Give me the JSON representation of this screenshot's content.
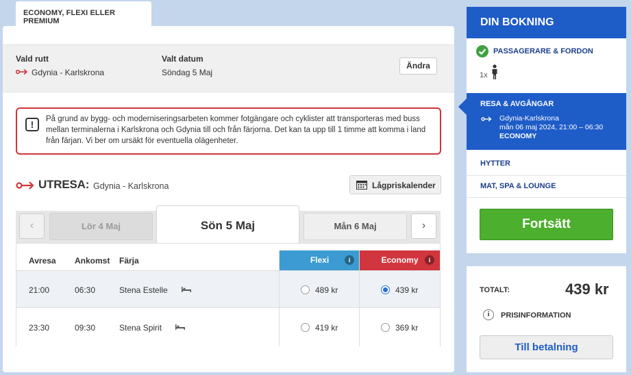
{
  "tab": {
    "label": "ECONOMY, FLEXI ELLER PREMIUM"
  },
  "route": {
    "route_label": "Vald rutt",
    "route_value": "Gdynia - Karlskrona",
    "date_label": "Valt datum",
    "date_value": "Söndag 5 Maj",
    "change_button": "Ändra"
  },
  "alert": {
    "icon": "!",
    "text": "På grund av bygg- och moderniseringsarbeten kommer fotgängare och cyklister att transporteras med buss mellan terminalerna i Karlskrona och Gdynia till och från färjorna. Det kan ta upp till 1 timme att komma i land från färjan. Vi ber om ursäkt för eventuella olägenheter."
  },
  "outbound": {
    "title": "UTRESA:",
    "route": "Gdynia - Karlskrona",
    "calendar_button": "Lågpriskalender"
  },
  "dates": {
    "prev": "Lör 4 Maj",
    "selected": "Sön 5 Maj",
    "next": "Mån 6 Maj",
    "left_arrow": "‹",
    "right_arrow": "›"
  },
  "table": {
    "headers": {
      "depart": "Avresa",
      "arrive": "Ankomst",
      "ferry": "Färja",
      "flexi": "Flexi",
      "economy": "Economy",
      "info": "i"
    },
    "rows": [
      {
        "depart": "21:00",
        "arrive": "06:30",
        "ferry": "Stena Estelle",
        "flexi_price": "489 kr",
        "economy_price": "439 kr",
        "selected": "economy"
      },
      {
        "depart": "23:30",
        "arrive": "09:30",
        "ferry": "Stena Spirit",
        "flexi_price": "419 kr",
        "economy_price": "369 kr",
        "selected": "none"
      }
    ]
  },
  "booking": {
    "title": "DIN BOKNING",
    "step_passengers": "PASSAGERARE & FORDON",
    "passenger_count": "1x",
    "step_trip": "RESA & AVGÅNGAR",
    "trip_route": "Gdynia-Karlskrona",
    "trip_time": "mån 06 maj 2024, 21:00 – 06:30",
    "trip_class": "ECONOMY",
    "step_cabins": "HYTTER",
    "step_food": "MAT, SPA & LOUNGE",
    "continue_button": "Fortsätt"
  },
  "total": {
    "label": "TOTALT:",
    "amount": "439 kr",
    "price_info": "PRISINFORMATION",
    "info_icon": "i",
    "pay_button": "Till betalning"
  },
  "colors": {
    "brand_blue": "#1e5cc8",
    "accent_red": "#d1353d",
    "flexi_blue": "#3b9bd2",
    "continue_green": "#4caf2d"
  }
}
